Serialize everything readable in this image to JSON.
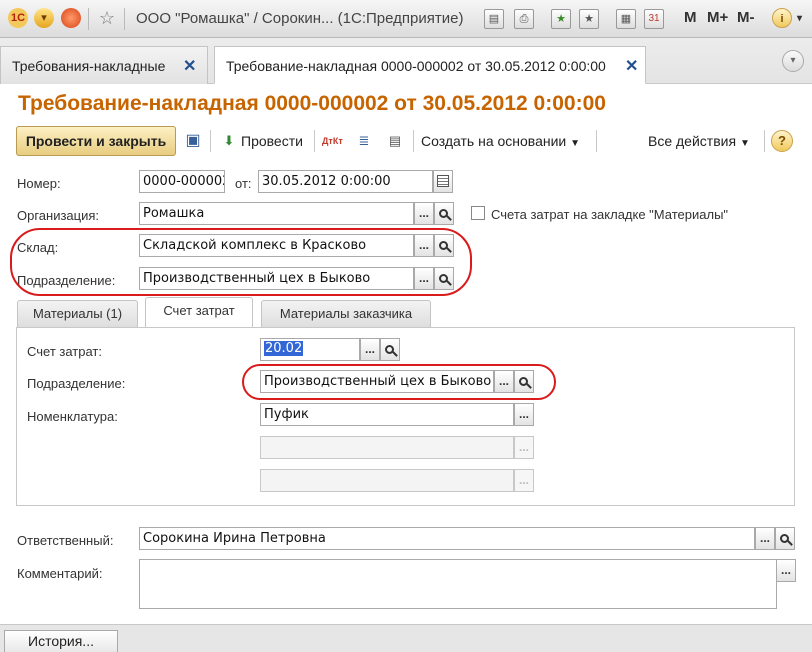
{
  "window": {
    "title": "ООО \"Ромашка\" / Сорокин... (1С:Предприятие)",
    "tools": [
      "M",
      "M+",
      "M-"
    ]
  },
  "tabs": [
    {
      "label": "Требования-накладные"
    },
    {
      "label": "Требование-накладная 0000-000002 от 30.05.2012 0:00:00"
    }
  ],
  "document": {
    "title": "Требование-накладная 0000-000002 от 30.05.2012 0:00:00"
  },
  "toolbar": {
    "post_close": "Провести и закрыть",
    "post": "Провести",
    "create_based": "Создать на основании",
    "all_actions": "Все действия",
    "help": "?"
  },
  "form": {
    "number_label": "Номер:",
    "number_value": "0000-000002",
    "date_label": "от:",
    "date_value": "30.05.2012  0:00:00",
    "org_label": "Организация:",
    "org_value": "Ромашка",
    "materials_checkbox_label": "Счета затрат на закладке \"Материалы\"",
    "warehouse_label": "Склад:",
    "warehouse_value": "Складской комплекс в Красково",
    "department_label": "Подразделение:",
    "department_value": "Производственный цех в Быково"
  },
  "inner_tabs": [
    "Материалы (1)",
    "Счет затрат",
    "Материалы заказчика"
  ],
  "cost_tab": {
    "account_label": "Счет затрат:",
    "account_value": "20.02",
    "department_label": "Подразделение:",
    "department_value": "Производственный цех в Быково",
    "nomenclature_label": "Номенклатура:",
    "nomenclature_value": "Пуфик"
  },
  "footer": {
    "responsible_label": "Ответственный:",
    "responsible_value": "Сорокина Ирина Петровна",
    "comment_label": "Комментарий:"
  },
  "history_button": "История..."
}
